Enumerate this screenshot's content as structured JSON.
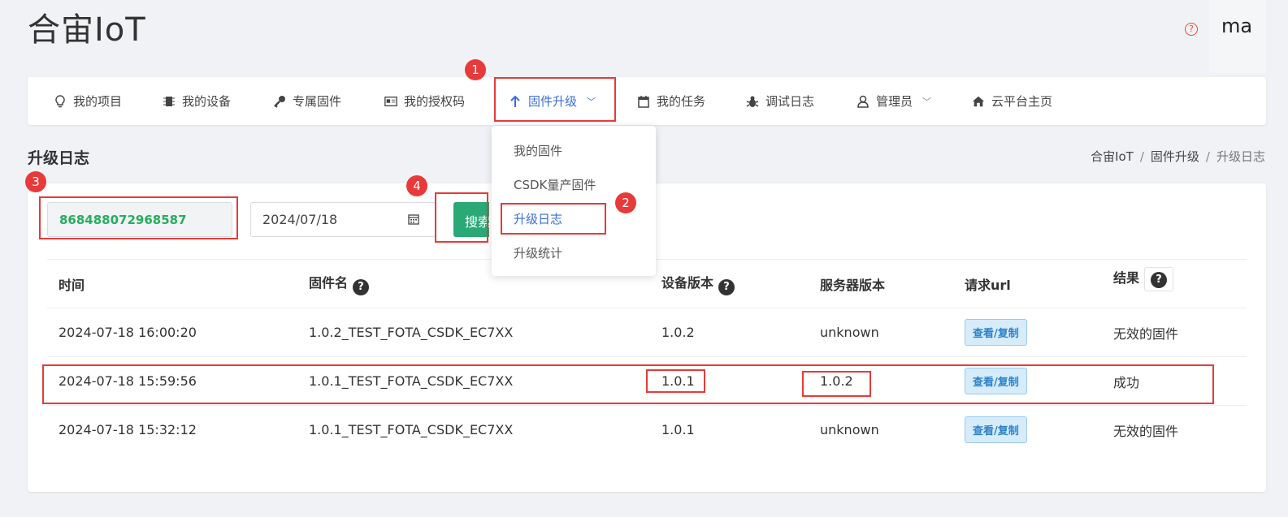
{
  "header": {
    "brand": "合宙IoT",
    "help_glyph": "?",
    "user": "ma"
  },
  "nav": [
    {
      "label": "我的项目",
      "icon": "lightbulb-icon"
    },
    {
      "label": "我的设备",
      "icon": "chip-icon"
    },
    {
      "label": "专属固件",
      "icon": "key-icon"
    },
    {
      "label": "我的授权码",
      "icon": "id-card-icon"
    },
    {
      "label": "固件升级",
      "icon": "arrow-up-icon",
      "active": true
    },
    {
      "label": "我的任务",
      "icon": "calendar-icon"
    },
    {
      "label": "调试日志",
      "icon": "bug-icon"
    },
    {
      "label": "管理员",
      "icon": "user-icon"
    },
    {
      "label": "云平台主页",
      "icon": "home-icon"
    }
  ],
  "dropdown": [
    "我的固件",
    "CSDK量产固件",
    "升级日志",
    "升级统计"
  ],
  "page": {
    "title": "升级日志",
    "breadcrumb": [
      "合宙IoT",
      "固件升级",
      "升级日志"
    ]
  },
  "filters": {
    "imei": "868488072968587",
    "date": "2024/07/18",
    "search_label": "搜索"
  },
  "table": {
    "headers": [
      "时间",
      "固件名",
      "设备版本",
      "服务器版本",
      "请求url",
      "结果"
    ],
    "help_glyph": "?",
    "view_label": "查看/复制",
    "rows": [
      {
        "time": "2024-07-18 16:00:20",
        "firmware": "1.0.2_TEST_FOTA_CSDK_EC7XX",
        "device_version": "1.0.2",
        "server_version": "unknown",
        "result": "无效的固件"
      },
      {
        "time": "2024-07-18 15:59:56",
        "firmware": "1.0.1_TEST_FOTA_CSDK_EC7XX",
        "device_version": "1.0.1",
        "server_version": "1.0.2",
        "result": "成功"
      },
      {
        "time": "2024-07-18 15:32:12",
        "firmware": "1.0.1_TEST_FOTA_CSDK_EC7XX",
        "device_version": "1.0.1",
        "server_version": "unknown",
        "result": "无效的固件"
      }
    ]
  },
  "annotations": {
    "markers": [
      "1",
      "2",
      "3",
      "4"
    ],
    "color": "#e83a3a"
  },
  "colors": {
    "accent": "#3a6fd8",
    "success": "#2aa876",
    "imei_text": "#27ae60"
  }
}
